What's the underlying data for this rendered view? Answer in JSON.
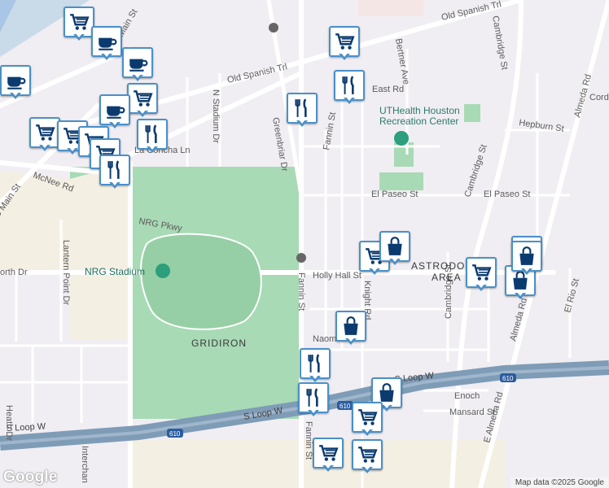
{
  "map": {
    "attribution": "Map data ©2025 Google",
    "logo_text": "Google",
    "pin_color": "#4a90c8",
    "park_color": "#a8dab5",
    "highway_color": "#7f9cb7",
    "water_color": "#aac6e6"
  },
  "labels": {
    "old_spanish_trl_top": "Old Spanish Trl",
    "old_spanish_trl_mid": "Old Spanish Trl",
    "s_main_st": "S Main St",
    "mcnee_rd": "McNee Rd",
    "la_concha_ln": "La Concha Ln",
    "nrg_pkwy": "NRG Pkwy",
    "nrg_stadium": "NRG Stadium",
    "lantern_point_dr": "Lantern Point Dr",
    "n_stadium_dr": "N Stadium Dr",
    "greenbriar_dr": "Greenbriar Dr",
    "fannin_st_top": "Fannin St",
    "fannin_st_mid": "Fannin St",
    "fannin_st_bottom": "Fannin St",
    "bertner_ave": "Bertner Ave",
    "east_rd": "East Rd",
    "uthealth": "UTHealth Houston",
    "recreation_center": "Recreation Center",
    "hepburn_st": "Hepburn St",
    "cambridge_st_top": "Cambridge St",
    "cambridge_st_mid": "Cambridge St",
    "cambridge_st_low": "Cambridge St",
    "el_paseo_st_left": "El Paseo St",
    "el_paseo_st_right": "El Paseo St",
    "holly_hall_st": "Holly Hall St",
    "knight_rd": "Knight Rd",
    "astrodome": "ASTRODOME",
    "area": "AREA",
    "gridiron": "GRIDIRON",
    "naomi": "Naom",
    "s_loop_w_left": "S Loop W",
    "s_loop_w_mid": "S Loop W",
    "s_loop_w_right": "S Loop W",
    "enoch": "Enoch",
    "mansard_st": "Mansard St",
    "e_almeda_rd": "E Almeda Rd",
    "almeda_rd_top": "Almeda Rd",
    "almeda_rd_mid": "Almeda Rd",
    "el_rio_st": "El Rio St",
    "cordi": "Cordi",
    "orth_dr": "orth Dr",
    "heath_dr": "Heath Dr",
    "interchange": "Interchan",
    "rd": "Rd",
    "i610_a": "610",
    "i610_b": "610",
    "i610_c": "610"
  },
  "pins": [
    {
      "icon": "cart"
    },
    {
      "icon": "coffee"
    },
    {
      "icon": "coffee"
    },
    {
      "icon": "coffee"
    },
    {
      "icon": "cart"
    },
    {
      "icon": "coffee"
    },
    {
      "icon": "cart"
    },
    {
      "icon": "cart"
    },
    {
      "icon": "cart"
    },
    {
      "icon": "fork-knife"
    },
    {
      "icon": "cart"
    },
    {
      "icon": "fork-knife"
    },
    {
      "icon": "cart"
    },
    {
      "icon": "fork-knife"
    },
    {
      "icon": "fork-knife"
    },
    {
      "icon": "cart"
    },
    {
      "icon": "bag"
    },
    {
      "icon": "cart"
    },
    {
      "icon": "cart"
    },
    {
      "icon": "bag"
    },
    {
      "icon": "cart"
    },
    {
      "icon": "bag"
    },
    {
      "icon": "bag"
    },
    {
      "icon": "fork-knife"
    },
    {
      "icon": "fork-knife"
    },
    {
      "icon": "bag"
    },
    {
      "icon": "cart"
    },
    {
      "icon": "cart"
    }
  ]
}
